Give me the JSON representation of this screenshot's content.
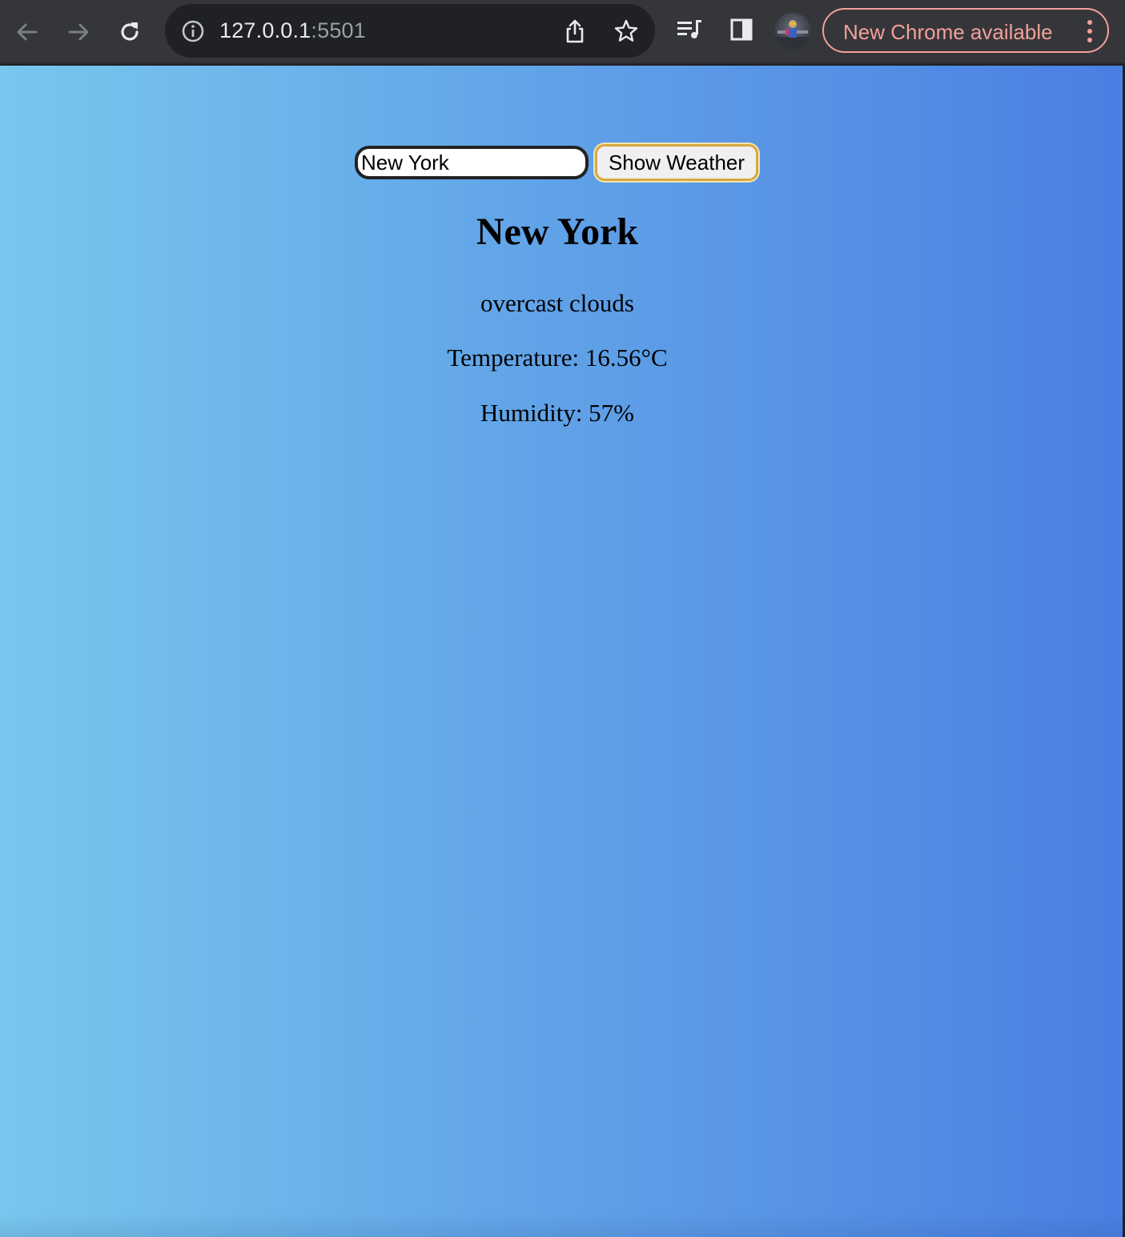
{
  "browser": {
    "url_host": "127.0.0.1",
    "url_port": ":5501",
    "update_label": "New Chrome available",
    "icons": {
      "back": "arrow-left-icon",
      "forward": "arrow-right-icon",
      "reload": "reload-icon",
      "site_info": "info-icon",
      "share": "share-icon",
      "bookmark": "star-icon",
      "media": "media-queue-icon",
      "side_panel": "side-panel-icon",
      "menu": "kebab-menu-icon"
    },
    "colors": {
      "toolbar": "#35363a",
      "omnibox": "#202124",
      "update_accent": "#f2a099"
    }
  },
  "page": {
    "background": {
      "from": "#78c7ee",
      "to": "#4a7fe3"
    },
    "search": {
      "value": "New York",
      "button_label": "Show Weather"
    },
    "weather": {
      "city": "New York",
      "description": "overcast clouds",
      "temperature": "Temperature: 16.56°C",
      "humidity": "Humidity: 57%"
    }
  }
}
